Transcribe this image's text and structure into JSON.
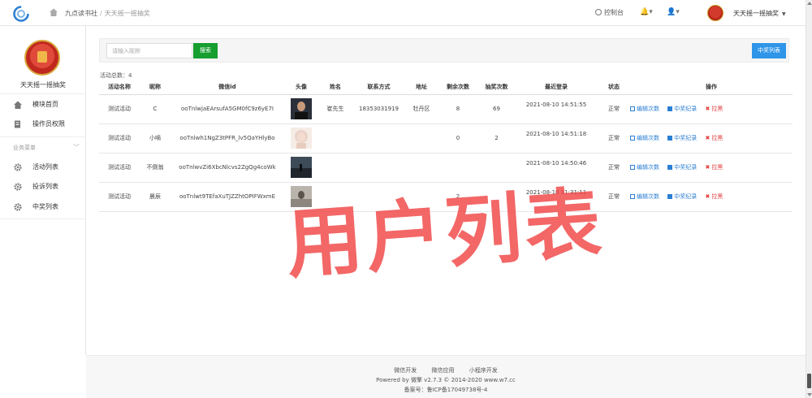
{
  "header": {
    "breadcrumb": {
      "site": "九点读书社",
      "separator": "/",
      "current": "天天摇一摇抽奖"
    },
    "console_label": "控制台",
    "user_name": "天天摇一摇抽奖"
  },
  "sidebar": {
    "account_name": "天天摇一摇抽奖",
    "top_items": [
      {
        "label": "模块首页",
        "icon": "home-icon"
      },
      {
        "label": "操作员权限",
        "icon": "document-icon"
      }
    ],
    "group_label": "业务菜单",
    "group_items": [
      {
        "label": "活动列表",
        "icon": "gear-icon"
      },
      {
        "label": "投诉列表",
        "icon": "gear-icon"
      },
      {
        "label": "中奖列表",
        "icon": "gear-icon"
      }
    ]
  },
  "search": {
    "placeholder": "请输入昵称",
    "button_label": "搜索",
    "winner_list_label": "中奖列表"
  },
  "summary": {
    "total_text": "活动总数：4"
  },
  "table": {
    "headers": [
      "活动名称",
      "昵称",
      "微信id",
      "头像",
      "姓名",
      "联系方式",
      "地址",
      "剩余次数",
      "抽奖次数",
      "最近登录",
      "状态",
      "操作"
    ],
    "actions": {
      "edit": "编辑次数",
      "winning": "中奖纪录",
      "blacklist": "拉黑"
    },
    "rows": [
      {
        "activity": "测试活动",
        "nickname": "C",
        "wechat_id": "ooTnlwjaEArsufA5GM0fC9z6yE7I",
        "name": "崔先生",
        "phone": "18353031919",
        "address": "牡丹区",
        "remaining": "8",
        "draws": "69",
        "last_login": "2021-08-10 14:51:55",
        "status": "正常"
      },
      {
        "activity": "测试活动",
        "nickname": "小嘀",
        "wechat_id": "ooTnlwh1NgZ3tPFR_lv5QaYHlyBo",
        "name": "",
        "phone": "",
        "address": "",
        "remaining": "0",
        "draws": "2",
        "last_login": "2021-08-10 14:51:18",
        "status": "正常"
      },
      {
        "activity": "测试活动",
        "nickname": "不倒翁",
        "wechat_id": "ooTnlwvZi6XbcNlcvs2ZgQg4coWk",
        "name": "",
        "phone": "",
        "address": "",
        "remaining": "",
        "draws": "",
        "last_login": "2021-08-10 14:50:46",
        "status": "正常"
      },
      {
        "activity": "测试活动",
        "nickname": "晨辰",
        "wechat_id": "ooTnlwt9TEfaXuTJZZhtOPIFWxmE",
        "name": "",
        "phone": "",
        "address": "",
        "remaining": "2",
        "draws": "",
        "last_login": "2021-08-10 11:31:11",
        "status": "正常"
      }
    ]
  },
  "watermark": "用户列表",
  "footer": {
    "links": [
      "微信开发",
      "微信应用",
      "小程序开发"
    ],
    "powered": "Powered by 微擎 v2.7.3 © 2014-2020 www.w7.cc",
    "icp": "备案号：鲁ICP备17049738号-4"
  },
  "colors": {
    "search_button": "#169e2f",
    "primary_button": "#2e95e8",
    "link": "#2b7fd3",
    "danger": "#e23b3b",
    "watermark": "#f04646"
  }
}
